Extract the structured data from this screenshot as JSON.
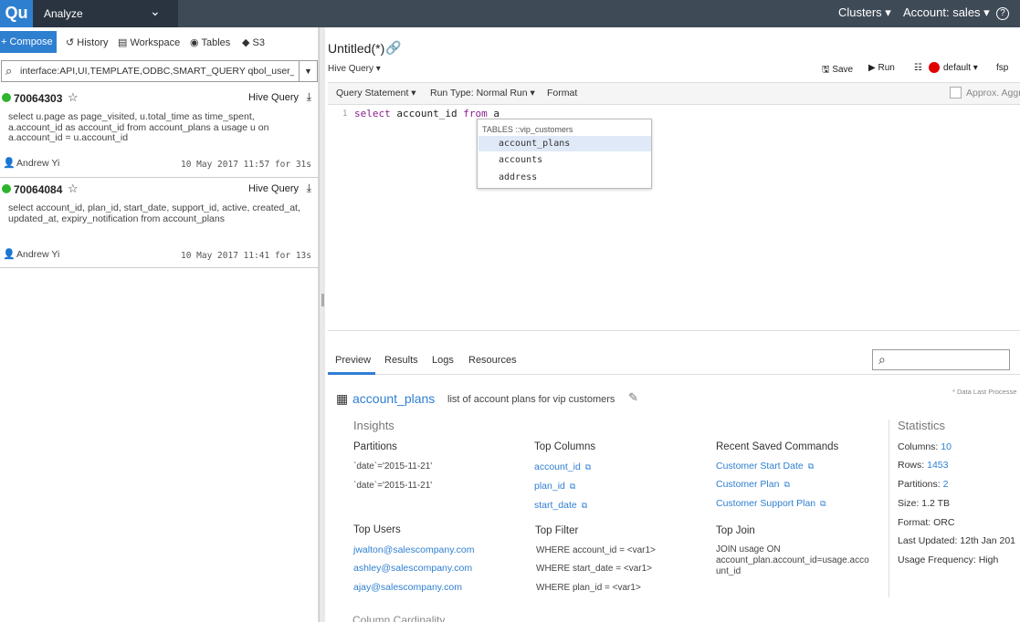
{
  "topbar": {
    "logo": "Qu",
    "section": "Analyze",
    "clusters": "Clusters",
    "account": "Account: sales",
    "help": "?"
  },
  "left": {
    "compose": "+ Compose",
    "tabs": [
      "History",
      "Workspace",
      "Tables",
      "S3"
    ],
    "search_value": "interface:API,UI,TEMPLATE,ODBC,SMART_QUERY qbol_user_id:q",
    "history": [
      {
        "id": "70064303",
        "type": "Hive Query",
        "query": "select u.page as page_visited, u.total_time as time_spent, a.account_id as account_id from account_plans a usage u on a.account_id = u.account_id",
        "user": "Andrew Yi",
        "time": "10 May 2017 11:57 for 31s"
      },
      {
        "id": "70064084",
        "type": "Hive Query",
        "query": "select account_id, plan_id, start_date, support_id, active, created_at, updated_at, expiry_notification from account_plans",
        "user": "Andrew Yi",
        "time": "10 May 2017 11:41 for 13s"
      }
    ]
  },
  "editor": {
    "title": "Untitled(*)",
    "command_type": "Hive Query",
    "save": "Save",
    "run": "Run",
    "cluster": "default",
    "fsp": "fsp",
    "query_statement": "Query Statement",
    "run_type": "Run Type: Normal Run",
    "format": "Format",
    "approx": "Approx. Aggr",
    "line_number": "1",
    "code_keyword1": "select",
    "code_mid": " account_id ",
    "code_keyword2": "from",
    "code_end": " a",
    "autocomplete": {
      "header": "TABLES ::vip_customers",
      "items": [
        "account_plans",
        "accounts",
        "address"
      ]
    }
  },
  "preview": {
    "tabs": [
      "Preview",
      "Results",
      "Logs",
      "Resources"
    ],
    "table_name": "account_plans",
    "table_desc": "list of account plans for vip customers",
    "data_last": "* Data Last Processe",
    "insights_title": "Insights",
    "partitions_title": "Partitions",
    "partitions": [
      "`date`='2015-11-21'",
      "`date`='2015-11-21'"
    ],
    "top_columns_title": "Top Columns",
    "top_columns": [
      "account_id",
      "plan_id",
      "start_date"
    ],
    "recent_title": "Recent Saved Commands",
    "recent": [
      "Customer Start Date",
      "Customer Plan",
      "Customer Support Plan"
    ],
    "top_users_title": "Top Users",
    "top_users": [
      "jwalton@salescompany.com",
      "ashley@salescompany.com",
      "ajay@salescompany.com"
    ],
    "top_filter_title": "Top Filter",
    "top_filter": [
      "WHERE account_id = <var1>",
      "WHERE start_date = <var1>",
      "WHERE plan_id = <var1>"
    ],
    "top_join_title": "Top Join",
    "top_join": [
      "JOIN usage ON",
      "account_plan.account_id=usage.acco",
      "unt_id"
    ],
    "statistics_title": "Statistics",
    "stats": {
      "columns_label": "Columns:",
      "columns": "10",
      "rows_label": "Rows:",
      "rows": "1453",
      "partitions_label": "Partitions:",
      "partitions": "2",
      "size": "Size: 1.2 TB",
      "format": "Format: ORC",
      "updated": "Last Updated: 12th Jan 201",
      "frequency": "Usage Frequency: High"
    },
    "column_cardinality": "Column Cardinality"
  }
}
